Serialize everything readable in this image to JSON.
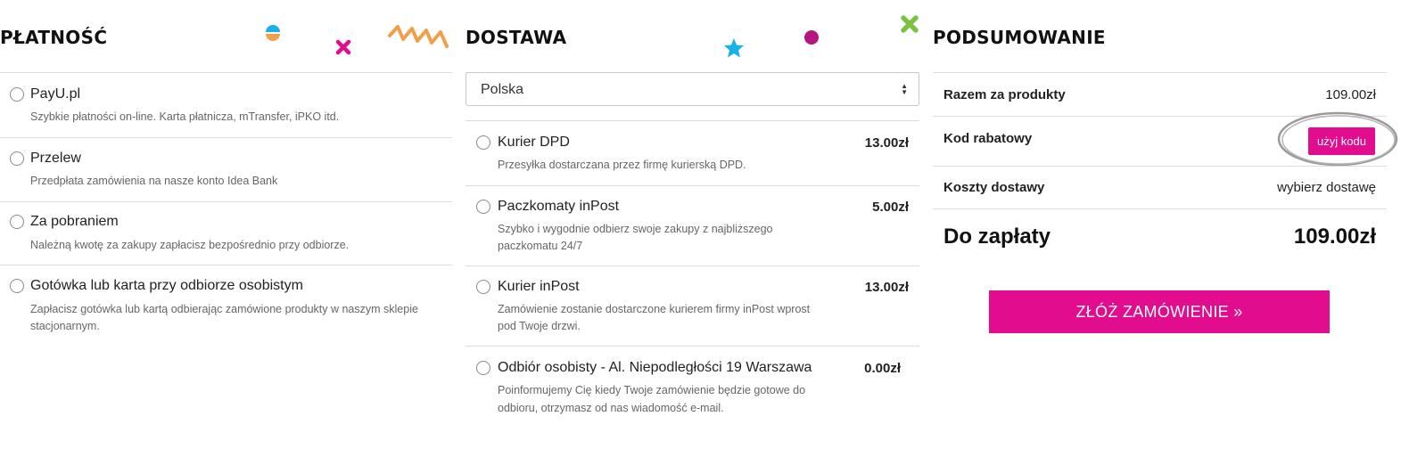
{
  "payment": {
    "title": "PŁATNOŚĆ",
    "options": [
      {
        "label": "PayU.pl",
        "desc": "Szybkie płatności on-line. Karta płatnicza, mTransfer, iPKO itd."
      },
      {
        "label": "Przelew",
        "desc": "Przedpłata zamówienia na nasze konto Idea Bank"
      },
      {
        "label": "Za pobraniem",
        "desc": "Należną kwotę za zakupy zapłacisz bezpośrednio przy odbiorze."
      },
      {
        "label": "Gotówka lub karta przy odbiorze osobistym",
        "desc1": "Zapłacisz gotówka lub kartą odbierając zamówione produkty w naszym sklepie",
        "desc2": "stacjonarnym."
      }
    ]
  },
  "delivery": {
    "title": "DOSTAWA",
    "country": "Polska",
    "options": [
      {
        "label": "Kurier DPD",
        "price": "13.00zł",
        "desc1": "Przesyłka dostarczana przez firmę kurierską DPD.",
        "desc2": ""
      },
      {
        "label": "Paczkomaty inPost",
        "price": "5.00zł",
        "desc1": "Szybko i wygodnie odbierz swoje zakupy z najbliższego",
        "desc2": "paczkomatu 24/7"
      },
      {
        "label": "Kurier inPost",
        "price": "13.00zł",
        "desc1": "Zamówienie zostanie dostarczone kurierem firmy inPost wprost",
        "desc2": "pod Twoje drzwi."
      },
      {
        "label": "Odbiór osobisty - Al. Niepodległości 19 Warszawa",
        "price": "0.00zł",
        "desc1": "Poinformujemy Cię kiedy Twoje zamówienie będzie gotowe do",
        "desc2": "odbioru, otrzymasz od nas wiadomość e-mail."
      }
    ]
  },
  "summary": {
    "title": "PODSUMOWANIE",
    "products_label": "Razem za produkty",
    "products_value": "109.00zł",
    "code_label": "Kod rabatowy",
    "code_button": "użyj kodu",
    "shipping_label": "Koszty dostawy",
    "shipping_value": "wybierz dostawę",
    "total_label": "Do zapłaty",
    "total_value": "109.00zł",
    "order_button": "ZŁÓŻ ZAMÓWIENIE »"
  },
  "colors": {
    "accent": "#e20d8e",
    "deco_orange": "#f0a04b",
    "deco_blue": "#1ab0e8",
    "deco_green": "#7cc242",
    "deco_purple": "#b5157e"
  }
}
